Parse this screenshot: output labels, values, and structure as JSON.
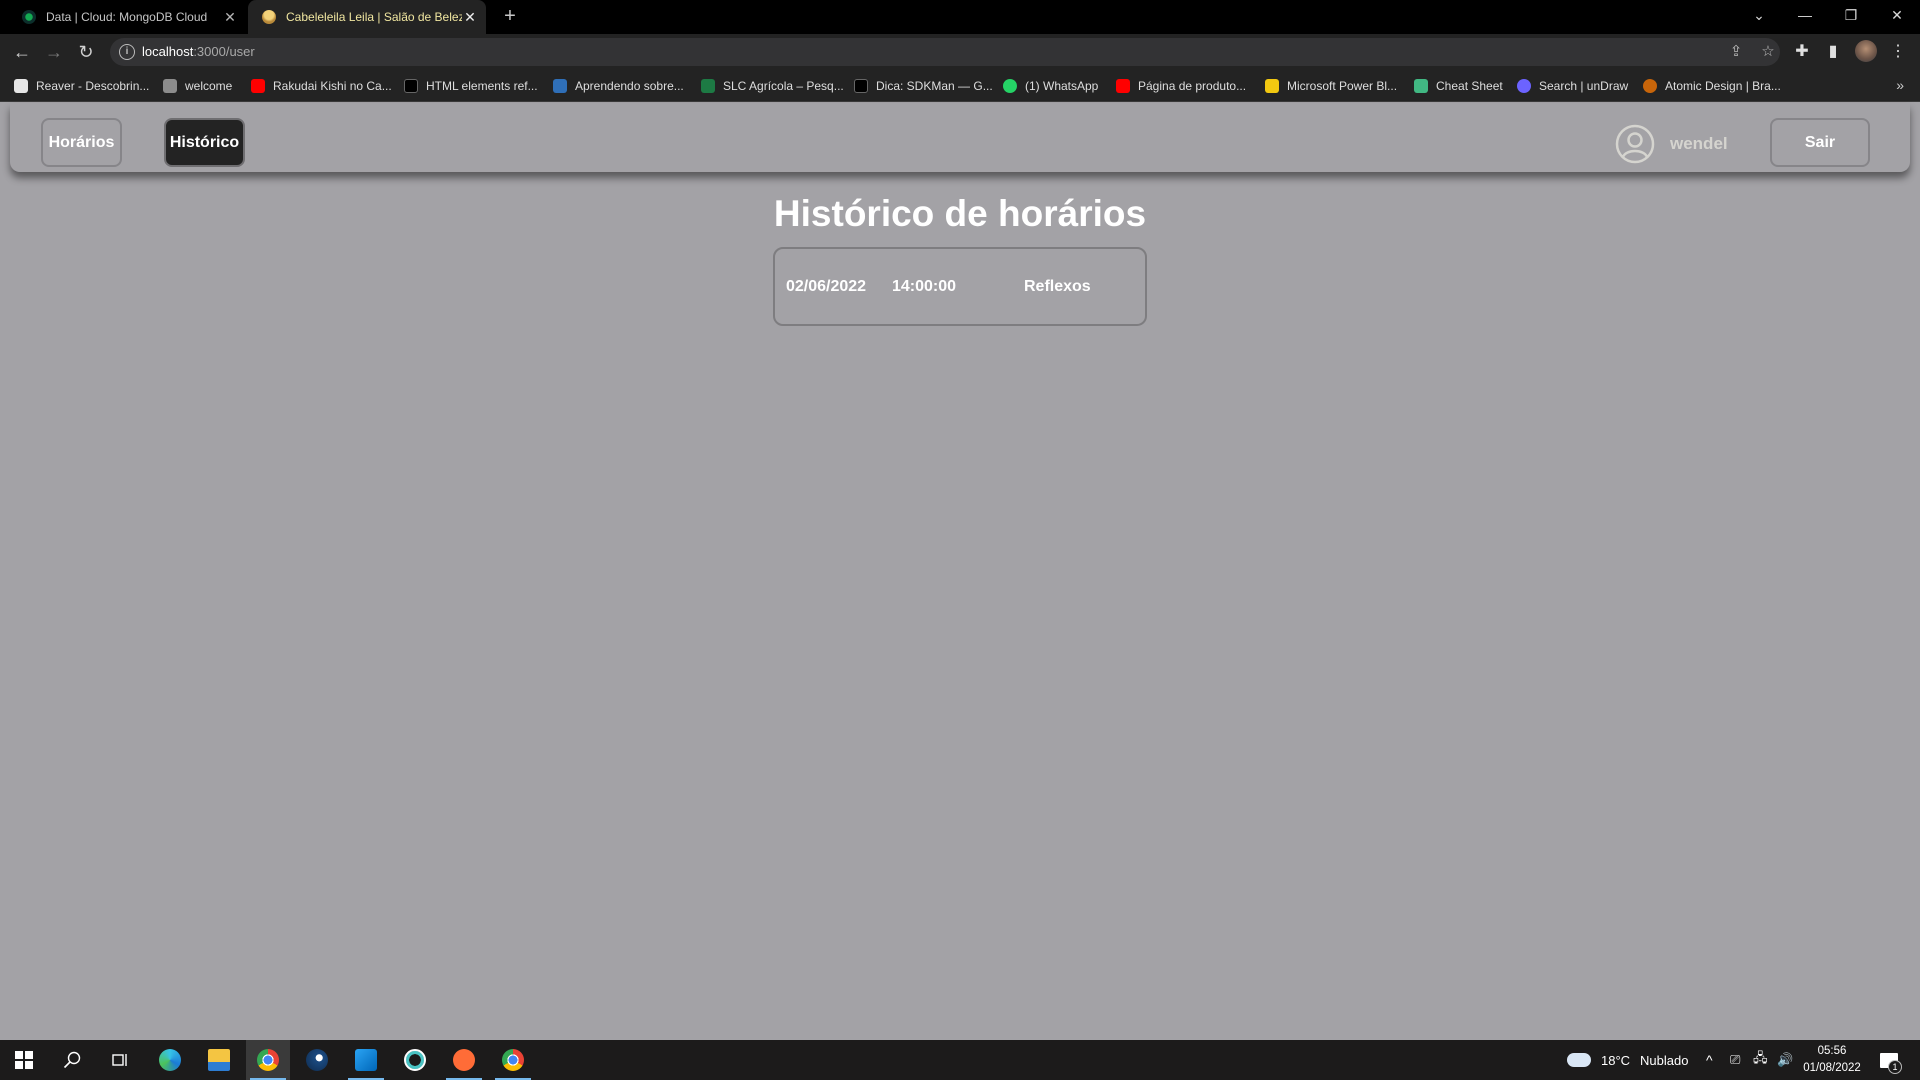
{
  "browser": {
    "tabs": [
      {
        "title": "Data | Cloud: MongoDB Cloud",
        "favicon": "mongodb-leaf-icon",
        "active": false
      },
      {
        "title": "Cabeleleila Leila | Salão de Beleza",
        "favicon": "salon-icon",
        "active": true
      }
    ],
    "url_host": "localhost",
    "url_path": ":3000/user",
    "bookmarks": [
      {
        "label": "Reaver - Descobrin...",
        "icon": "penguin-icon",
        "color": "#e6e6e6"
      },
      {
        "label": "welcome",
        "icon": "portrait-icon",
        "color": "#8c8c8c"
      },
      {
        "label": "Rakudai Kishi no Ca...",
        "icon": "youtube-icon",
        "color": "#ff0000"
      },
      {
        "label": "HTML elements ref...",
        "icon": "mdn-icon",
        "color": "#000000"
      },
      {
        "label": "Aprendendo sobre...",
        "icon": "cube-icon",
        "color": "#2f6fb8"
      },
      {
        "label": "SLC Agrícola – Pesq...",
        "icon": "slc-icon",
        "color": "#1d7a44"
      },
      {
        "label": "Dica: SDKMan — G...",
        "icon": "medium-icon",
        "color": "#000000"
      },
      {
        "label": "(1) WhatsApp",
        "icon": "whatsapp-icon",
        "color": "#25d366"
      },
      {
        "label": "Página de produto...",
        "icon": "youtube-icon",
        "color": "#ff0000"
      },
      {
        "label": "Microsoft Power Bl...",
        "icon": "powerbi-icon",
        "color": "#f2c811"
      },
      {
        "label": "Cheat Sheet",
        "icon": "vue-icon",
        "color": "#41b883"
      },
      {
        "label": "Search | unDraw",
        "icon": "undraw-icon",
        "color": "#6c63ff"
      },
      {
        "label": "Atomic Design | Bra...",
        "icon": "atomic-icon",
        "color": "#c8650a"
      }
    ]
  },
  "app": {
    "nav": {
      "horarios_label": "Horários",
      "historico_label": "Histórico",
      "username": "wendel",
      "logout_label": "Sair"
    },
    "title": "Histórico de horários",
    "history": [
      {
        "date": "02/06/2022",
        "time": "14:00:00",
        "service": "Reflexos"
      }
    ],
    "colors": {
      "background": "#a3a2a6",
      "active_button": "#232323",
      "border": "#868589"
    }
  },
  "taskbar": {
    "weather_temp": "18°C",
    "weather_desc": "Nublado",
    "time": "05:56",
    "date": "01/08/2022",
    "notifications": "1"
  }
}
